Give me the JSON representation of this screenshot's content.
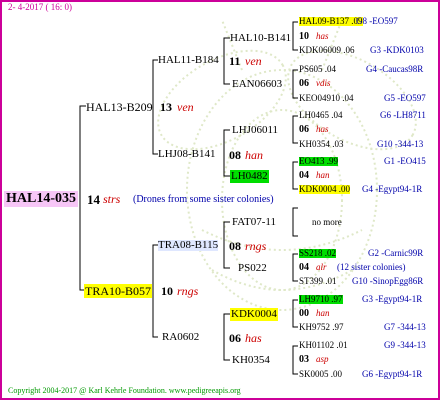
{
  "header": {
    "date": "2- 4-2017 ( 16: 0)"
  },
  "footer": {
    "copyright": "Copyright 2004-2017 @ Karl Kehrle Foundation.   www.pedigreeapis.org"
  },
  "root": {
    "name": "HAL14-035",
    "num": "14",
    "breed": "strs",
    "note": "(Drones from some sister colonies)"
  },
  "gen1": [
    {
      "name": "HAL13-B209",
      "num": "13",
      "breed": "ven"
    },
    {
      "name": "TRA10-B057",
      "num": "10",
      "breed": "rngs"
    }
  ],
  "gen2": [
    {
      "name": "HAL11-B184",
      "num": "11",
      "breed": "ven"
    },
    {
      "name": "LHJ08-B141",
      "num": "08",
      "breed": "han"
    },
    {
      "name": "TRA08-B115",
      "num": "08",
      "breed": "rngs"
    },
    {
      "name": "RA0602",
      "num": "06",
      "breed": "has"
    }
  ],
  "gen3": [
    {
      "name": "HAL10-B141",
      "num": "",
      "breed": ""
    },
    {
      "name": "EAN06603",
      "num": "",
      "breed": ""
    },
    {
      "name": "LHJ06011",
      "num": "",
      "breed": ""
    },
    {
      "name": "LH0482",
      "num": "",
      "breed": ""
    },
    {
      "name": "FAT07-11",
      "num": "",
      "breed": ""
    },
    {
      "name": "PS022",
      "num": "",
      "breed": ""
    },
    {
      "name": "KDK0004",
      "num": "",
      "breed": ""
    },
    {
      "name": "KH0354",
      "num": "",
      "breed": ""
    }
  ],
  "gen4": [
    {
      "top": "HAL09-B137 .09",
      "topcode": "G8 -EO597",
      "num": "10",
      "breed": "has",
      "bot": "KDK06009 .06",
      "botcode": "G3 -KDK0103"
    },
    {
      "top": "PS605 .04",
      "topcode": "G4 -Caucas98R",
      "num": "06",
      "breed": "vdis",
      "bot": "KEO04910 .04",
      "botcode": "G5 -EO597"
    },
    {
      "top": "LH0465 .04",
      "topcode": "G6 -LH8711",
      "num": "06",
      "breed": "has",
      "bot": "KH0354 .03",
      "botcode": "G10 -344-13"
    },
    {
      "top": "EO413 .99",
      "topcode": "G1 -EO415",
      "num": "04",
      "breed": "han",
      "bot": "KDK0004 .00",
      "botcode": "G4 -Egypt94-1R"
    },
    {
      "nomore": "no more"
    },
    {
      "top": "SS218 .02",
      "topcode": "G2 -Carnic99R",
      "num": "04",
      "breed": "alr",
      "note": "(12 sister colonies)",
      "bot": "ST399 .01",
      "botcode": "G10 -SinopEgg86R"
    },
    {
      "top": "LH9710 .97",
      "topcode": "G3 -Egypt94-1R",
      "num": "00",
      "breed": "han",
      "bot": "KH9752 .97",
      "botcode": "G7 -344-13"
    },
    {
      "top": "KH01102 .01",
      "topcode": "G9 -344-13",
      "num": "03",
      "breed": "asp",
      "bot": "SK0005 .00",
      "botcode": "G6 -Egypt94-1R"
    }
  ],
  "colors": {
    "frame": "#cc0099",
    "breed": "#cc0000",
    "code": "#0000aa",
    "highlight_yellow": "#ffff00",
    "highlight_green": "#00dd00",
    "root_bg": "#f7c6f7"
  }
}
